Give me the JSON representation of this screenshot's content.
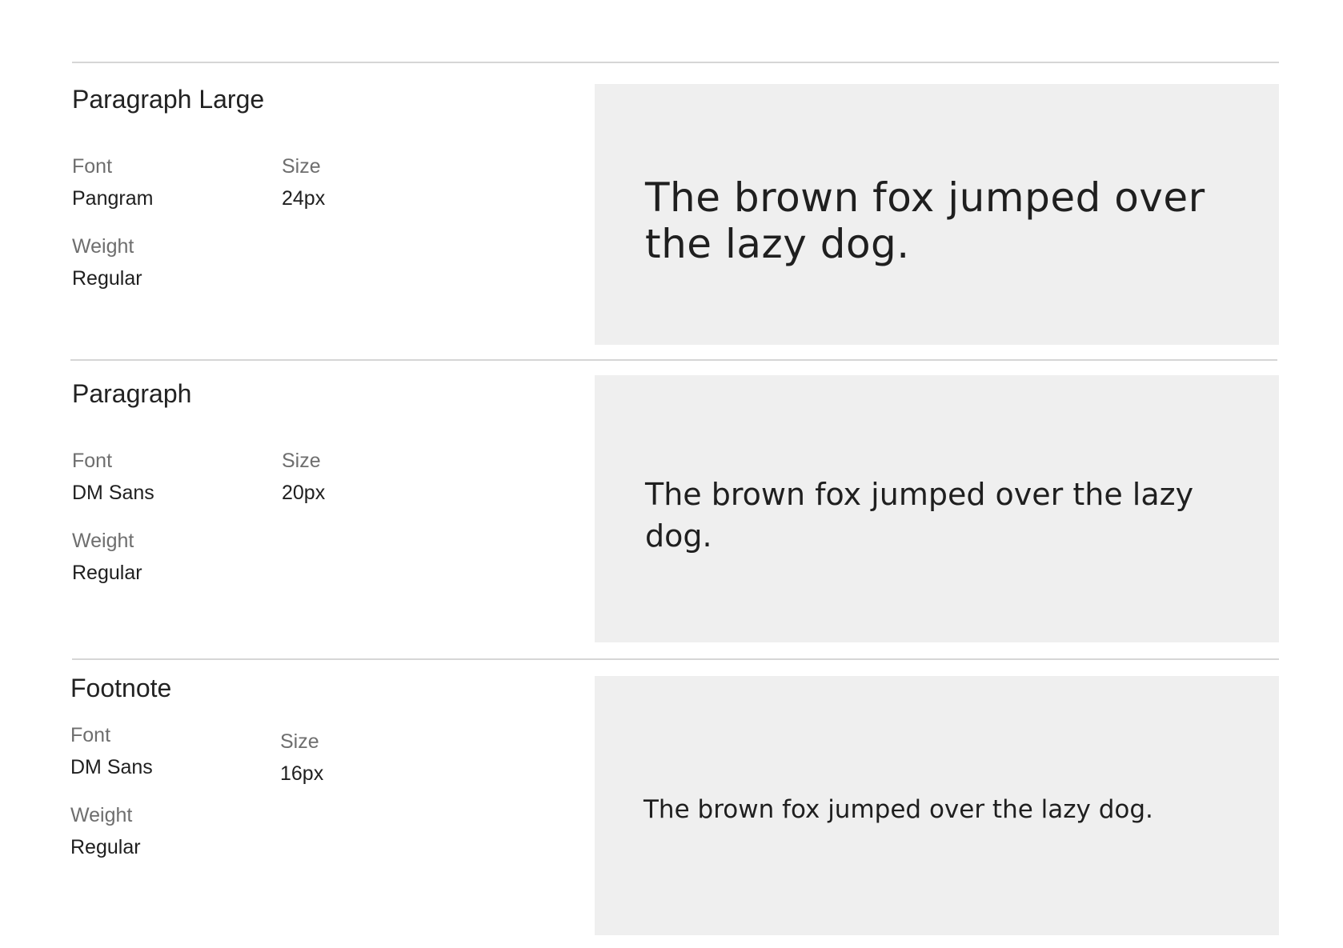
{
  "labels": {
    "font": "Font",
    "size": "Size",
    "weight": "Weight"
  },
  "styles": [
    {
      "name": "Paragraph Large",
      "font": "Pangram",
      "size": "24px",
      "weight": "Regular",
      "sample": "The brown fox jumped over the lazy dog."
    },
    {
      "name": "Paragraph",
      "font": "DM Sans",
      "size": "20px",
      "weight": "Regular",
      "sample": "The brown fox jumped over the lazy dog."
    },
    {
      "name": "Footnote",
      "font": "DM Sans",
      "size": "16px",
      "weight": "Regular",
      "sample": "The brown fox jumped over the lazy dog."
    }
  ],
  "colors": {
    "divider": "#d6d6d6",
    "preview_background": "#efefef",
    "label": "#6e6e6e",
    "text": "#1f1f1f"
  }
}
